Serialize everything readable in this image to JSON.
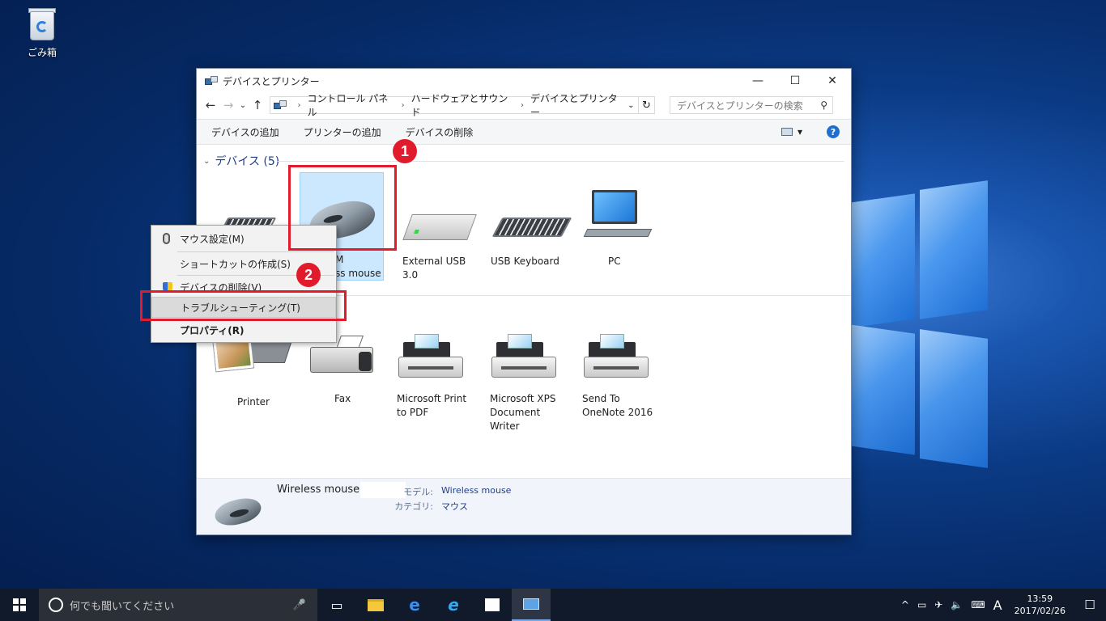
{
  "desktop": {
    "recycle_bin_label": "ごみ箱"
  },
  "window": {
    "title": "デバイスとプリンター",
    "controls": {
      "minimize": "—",
      "maximize": "☐",
      "close": "✕"
    }
  },
  "address": {
    "back": "←",
    "forward": "→",
    "recent": "⌄",
    "up": "↑",
    "crumbs": [
      "コントロール パネル",
      "ハードウェアとサウンド",
      "デバイスとプリンター"
    ],
    "dropdown": "⌄",
    "refresh": "↻",
    "search_placeholder": "デバイスとプリンターの検索",
    "search_icon": "⚲"
  },
  "commandbar": {
    "add_device": "デバイスの追加",
    "add_printer": "プリンターの追加",
    "remove_device": "デバイスの削除",
    "view_dropdown": "▾",
    "help": "?"
  },
  "devices_section": {
    "title": "デバイス (5)",
    "chevron": "⌄",
    "items": [
      {
        "label_line1": "M",
        "label_line2": "ss mouse",
        "icon": "mouse-icon"
      },
      {
        "label_line1": "External USB",
        "label_line2": "3.0",
        "icon": "hard-drive-icon"
      },
      {
        "label_line1": "USB Keyboard",
        "label_line2": "",
        "icon": "keyboard-icon"
      },
      {
        "label_line1": "PC",
        "label_line2": "",
        "icon": "laptop-icon"
      }
    ]
  },
  "printers_section": {
    "items": [
      {
        "label_line1": "Printer",
        "label_line2": "",
        "label_line3": "",
        "icon": "printer-icon"
      },
      {
        "label_line1": "Fax",
        "label_line2": "",
        "label_line3": "",
        "icon": "fax-icon"
      },
      {
        "label_line1": "Microsoft Print",
        "label_line2": "to PDF",
        "label_line3": "",
        "icon": "printer-icon"
      },
      {
        "label_line1": "Microsoft XPS",
        "label_line2": "Document",
        "label_line3": "Writer",
        "icon": "printer-icon"
      },
      {
        "label_line1": "Send To",
        "label_line2": "OneNote 2016",
        "label_line3": "",
        "icon": "printer-icon"
      }
    ]
  },
  "details": {
    "name": "Wireless mouse",
    "model_label": "モデル:",
    "model_value": "Wireless mouse",
    "category_label": "カテゴリ:",
    "category_value": "マウス"
  },
  "context_menu": {
    "items": [
      {
        "label": "マウス設定(M)"
      },
      {
        "label": "ショートカットの作成(S)"
      },
      {
        "label": "デバイスの削除(V)"
      },
      {
        "label": "トラブルシューティング(T)"
      },
      {
        "label": "プロパティ(R)"
      }
    ]
  },
  "annotations": {
    "badge1": "1",
    "badge2": "2",
    "color": "#e11b2b"
  },
  "taskbar": {
    "search_placeholder": "何でも聞いてください",
    "mic": "🎤",
    "tray_chevron": "^",
    "ime": "A",
    "time": "13:59",
    "date": "2017/02/26",
    "notification": "☐"
  }
}
